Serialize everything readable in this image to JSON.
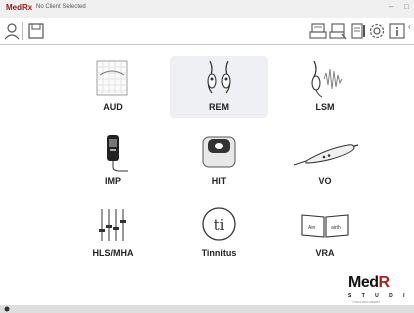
{
  "window": {
    "brand_med": "Med",
    "brand_rx": "Rx",
    "title": "No Client Selected",
    "minimize": "–",
    "maximize": "□"
  },
  "tiles": [
    {
      "label": "AUD"
    },
    {
      "label": "REM",
      "selected": true
    },
    {
      "label": "LSM"
    },
    {
      "label": "IMP"
    },
    {
      "label": "HIT"
    },
    {
      "label": "VO"
    },
    {
      "label": "HLS/MHA"
    },
    {
      "label": "Tinnitus"
    },
    {
      "label": "VRA"
    }
  ],
  "vra_icon_text": {
    "left": "Ain",
    "right": "airth"
  },
  "brand_footer": {
    "line1_a": "Med",
    "line1_b": "R",
    "line2": "S T U D I",
    "line3": "©2013-2022 MEDRX"
  },
  "colors": {
    "brand_red": "#b31b1b",
    "selected_tile": "#eef0f3",
    "titlebar": "#f0f0f0"
  }
}
